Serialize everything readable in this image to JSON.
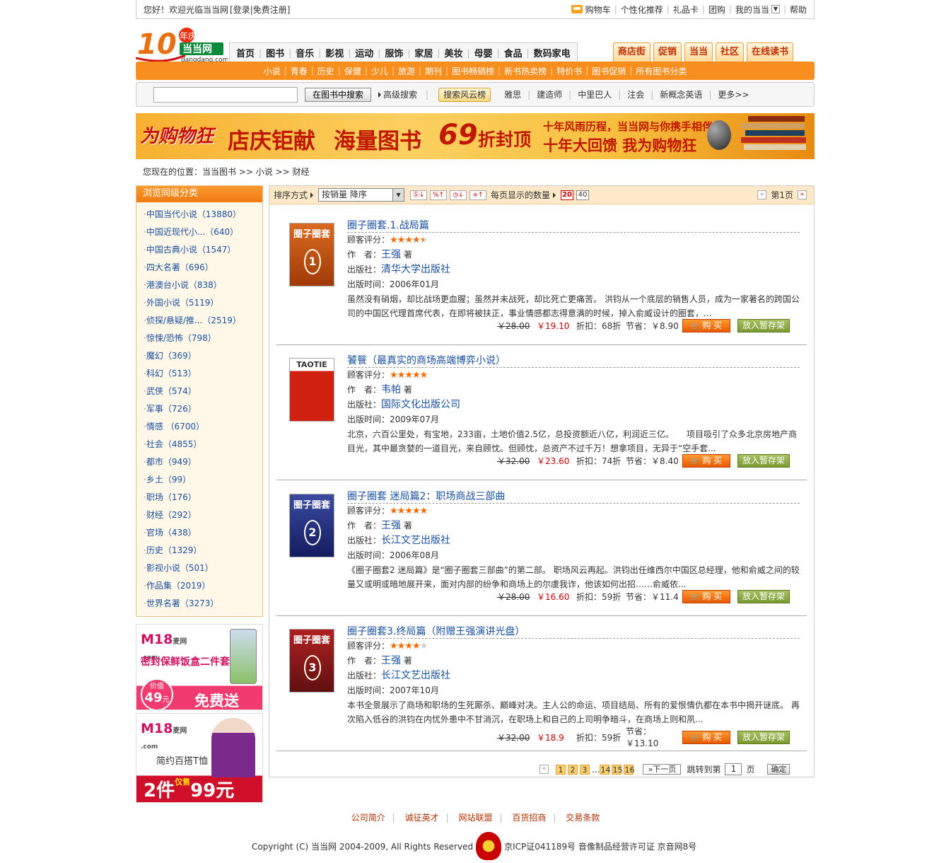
{
  "topbar": {
    "welcome": "您好！欢迎光临当当网",
    "login": "[登录",
    "register": "|免费注册]",
    "links": [
      "购物车",
      "个性化推荐",
      "礼品卡",
      "团购",
      "我的当当",
      "帮助"
    ]
  },
  "logo": {
    "text": "当当网",
    "sub": "dangdang.com",
    "years": "10",
    "badge": "年庆"
  },
  "mainnav": [
    "首页",
    "图书",
    "音乐",
    "影视",
    "运动",
    "服饰",
    "家居",
    "美妆",
    "母婴",
    "食品",
    "数码家电"
  ],
  "rightnav": [
    "商店街",
    "促销",
    "当当",
    "社区",
    "在线读书"
  ],
  "subnav": [
    "小说",
    "青春",
    "历史",
    "保健",
    "少儿",
    "旅游",
    "期刊",
    "图书畅销榜",
    "新书热卖榜",
    "特价书",
    "图书促销",
    "所有图书分类"
  ],
  "search": {
    "button": "在图书中搜索",
    "advanced": "高级搜索",
    "hot": "搜索风云榜",
    "hotlinks": [
      "雅思",
      "建造师",
      "中里巴人",
      "注会",
      "新概念英语",
      "更多>>"
    ]
  },
  "banner": {
    "logo": "为购物狂",
    "t1": "店庆钜献",
    "t2": "海量图书",
    "t3": "69",
    "t4": "折封顶",
    "t5": "十年风雨历程，当当网与你携手相伴",
    "t6": "十年大回馈 我为购物狂"
  },
  "breadcrumb": "您现在的位置：当当图书 >> 小说 >> 财经",
  "sidebar": {
    "title": "浏览同级分类",
    "items": [
      "中国当代小说（13880）",
      "中国近现代小...（640）",
      "中国古典小说（1547）",
      "四大名著（696）",
      "港澳台小说（838）",
      "外国小说（5119）",
      "侦探/悬疑/推...（2519）",
      "惊悚/恐怖（798）",
      "魔幻（369）",
      "科幻（513）",
      "武侠（574）",
      "军事（726）",
      "情感 （6700）",
      "社会（4855）",
      "都市（949）",
      "乡土（99）",
      "职场（176）",
      "财经（292）",
      "官场（438）",
      "历史（1329）",
      "影视小说（501）",
      "作品集（2019）",
      "世界名著（3273）"
    ]
  },
  "ads": [
    {
      "logo": "M18",
      "logo_sub": "麦网",
      "logo_url": ".com",
      "text": "密封保鲜饭盒二件套",
      "price_label": "价值",
      "price": "49",
      "price_unit": "元",
      "promo": "免费送"
    },
    {
      "logo": "M18",
      "logo_sub": "麦网",
      "logo_url": ".com",
      "text": "简约百搭T恤",
      "promo": "2件",
      "promo_small": "仅售",
      "promo_price": "99元"
    }
  ],
  "toolbar": {
    "sort_label": "排序方式",
    "sort_value": "按销量  降序",
    "perpage_label": "每页显示的数量",
    "perpage": [
      "20",
      "40"
    ],
    "page": "第1页"
  },
  "labels": {
    "rating": "顾客评分：",
    "author": "作　者：",
    "publisher": "出版社：",
    "date": "出版时间：",
    "discount": "折扣：",
    "save": "节省：",
    "buy": "购 买",
    "wish": "放入暂存架",
    "by": "著"
  },
  "items": [
    {
      "title": "圈子圈套.1.战局篇",
      "rating": 4.5,
      "author": "王强",
      "publisher": "清华大学出版社",
      "date": "2006年01月",
      "desc": "虽然没有硝烟，却比战场更血腥；虽然并未战死，却比死亡更痛苦。 洪钧从一个底层的销售人员，成为一家著名的跨国公司的中国区代理首席代表，在即将被扶正，事业情感都志得意满的时候，掉入俞威设计的圈套，...",
      "list_price": "￥28.00",
      "sale_price": "￥19.10",
      "discount": "68折",
      "save": "￥8.90",
      "cover_title": "圈子圈套",
      "cover_num": "1",
      "cover_color": "#c05010"
    },
    {
      "title": "饕餮（最真实的商场高端博弈小说）",
      "rating": 5,
      "author": "韦帕",
      "publisher": "国际文化出版公司",
      "date": "2009年07月",
      "desc": "北京，六百公里处，有宝地，233亩，土地价值2.5亿，总投资额近八亿，利润近三亿。　　项目吸引了众多北京房地产商目光，其中最贪婪的一道目光，来自顾忱。但顾忱，总资产不过千万！想拿项目，无异于“空手套...",
      "list_price": "￥32.00",
      "sale_price": "￥23.60",
      "discount": "74折",
      "save": "￥8.40",
      "cover_title": "TAOTIE",
      "cover_num": "",
      "cover_color": "#d02010"
    },
    {
      "title": "圈子圈套 迷局篇2：职场商战三部曲",
      "rating": 5,
      "author": "王强",
      "publisher": "长江文艺出版社",
      "date": "2006年08月",
      "desc": "《圈子圈套2 迷局篇》是“圈子圈套三部曲”的第二部。 职场风云再起。洪钧出任维西尔中国区总经理，他和俞威之间的较量又或明或暗地展开来，面对内部的纷争和商场上的尔虞我诈，他该如何出招……俞威依...",
      "list_price": "￥28.00",
      "sale_price": "￥16.60",
      "discount": "59折",
      "save": "￥11.4",
      "cover_title": "圈子圈套",
      "cover_num": "2",
      "cover_color": "#202a80"
    },
    {
      "title": "圈子圈套3.终局篇（附赠王强演讲光盘）",
      "rating": 4,
      "author": "王强",
      "publisher": "长江文艺出版社",
      "date": "2007年10月",
      "desc": "本书全景展示了商场和职场的生死厮杀、巅峰对决。主人公的命运、项目结局、所有的爱恨情仇都在本书中揭开谜底。 再次陷入低谷的洪钧在内忧外患中不甘消沉，在职场上和自己的上司明争暗斗，在商场上则和夙...",
      "list_price": "￥32.00",
      "sale_price": "￥18.9",
      "discount": "59折",
      "save": "￥13.10",
      "cover_title": "圈子圈套",
      "cover_num": "3",
      "cover_color": "#901818"
    }
  ],
  "pager": {
    "pages": [
      "1",
      "2",
      "3",
      "...",
      "14",
      "15",
      "16"
    ],
    "next": "»下一页",
    "jump": "跳转到第",
    "jump_value": "1",
    "page_unit": "页",
    "ok": "确定"
  },
  "footer": {
    "links": [
      "公司简介",
      "诚征英才",
      "网站联盟",
      "百货招商",
      "交易条款"
    ],
    "copyright": "Copyright (C) 当当网 2004-2009, All Rights Reserved",
    "icp": "京ICP证041189号 音像制品经营许可证 京音网8号"
  }
}
